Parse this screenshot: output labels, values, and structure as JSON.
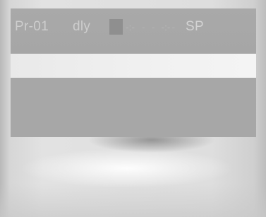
{
  "header": {
    "program_label": "Pr-01",
    "mode_label": "dly",
    "setpoint_label": "SP",
    "marker_glyph": "-:-",
    "dash_glyph": "- -"
  },
  "colors": {
    "panel": "#a7a7a7",
    "header_text": "#cdcdcd",
    "indicator": "#8f8f8f",
    "strip": "#f1f1f1"
  }
}
